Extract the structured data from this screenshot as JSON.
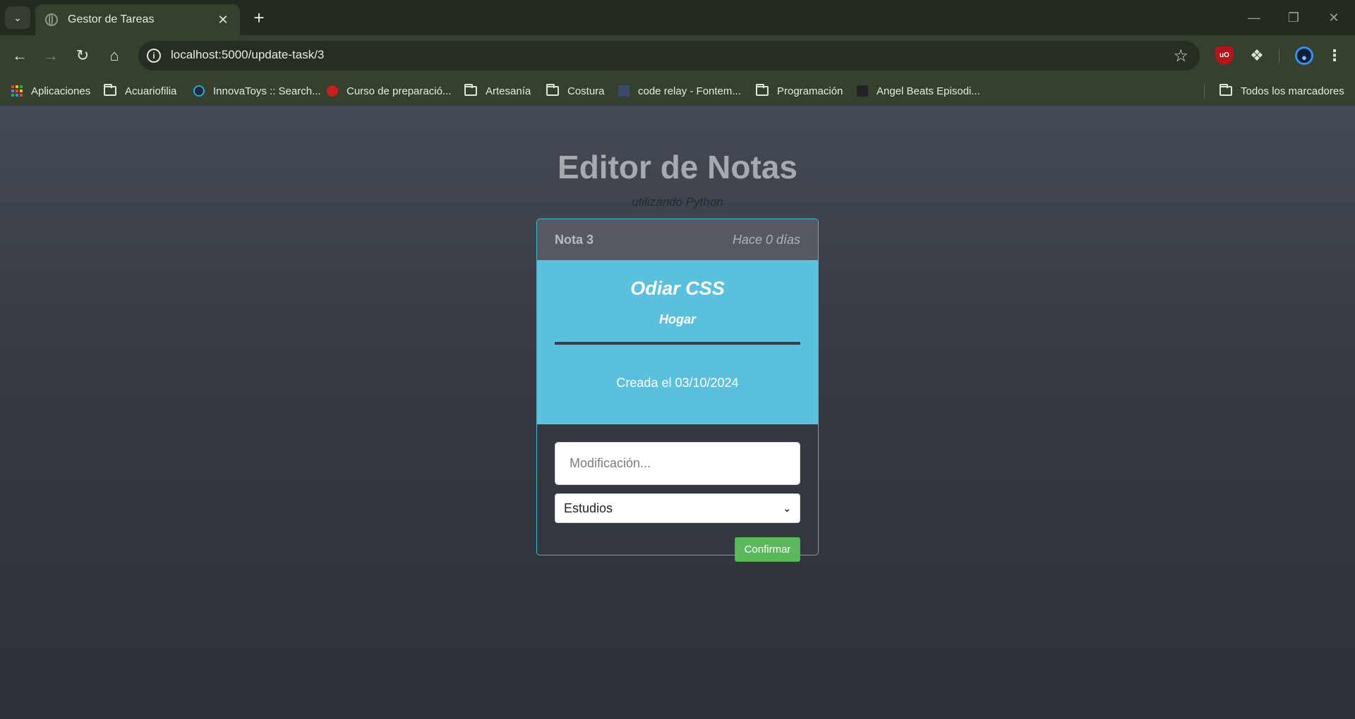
{
  "browser": {
    "tab_title": "Gestor de Tareas",
    "url": "localhost:5000/update-task/3",
    "icons": [
      "tab-search-icon",
      "globe-icon",
      "close-icon",
      "plus-icon",
      "back-icon",
      "forward-icon",
      "reload-icon",
      "home-icon",
      "info-icon",
      "star-icon",
      "ublock-icon",
      "puzzle-icon",
      "profile-icon",
      "menu-icon"
    ],
    "ublock_label": "uO",
    "bookmarks": [
      {
        "label": "Aplicaciones",
        "icon": "apps-icon"
      },
      {
        "label": "Acuariofilia",
        "icon": "folder-icon"
      },
      {
        "label": "InnovaToys :: Search...",
        "icon": "site-icon"
      },
      {
        "label": "Curso de preparació...",
        "icon": "site-icon"
      },
      {
        "label": "Artesanía",
        "icon": "folder-icon"
      },
      {
        "label": "Costura",
        "icon": "folder-icon"
      },
      {
        "label": "code relay - Fontem...",
        "icon": "site-icon"
      },
      {
        "label": "Programación",
        "icon": "folder-icon"
      },
      {
        "label": "Angel Beats Episodi...",
        "icon": "site-icon"
      },
      {
        "label": "Todos los marcadores",
        "icon": "folder-icon"
      }
    ],
    "colors": {
      "chrome": "#35402f",
      "tabstrip": "#232a1f"
    }
  },
  "app": {
    "title": "Editor de Notas",
    "subtitle": "utilizando Python"
  },
  "note": {
    "id_label": "Nota 3",
    "age": "Hace 0 días",
    "title": "Odiar CSS",
    "category": "Hogar",
    "created": "Creada el 03/10/2024"
  },
  "form": {
    "modification_placeholder": "Modificación...",
    "category_selected": "Estudios",
    "confirm_label": "Confirmar"
  },
  "colors": {
    "accent": "#5bc0de",
    "confirm": "#5cb85c",
    "card_header": "#545962"
  }
}
